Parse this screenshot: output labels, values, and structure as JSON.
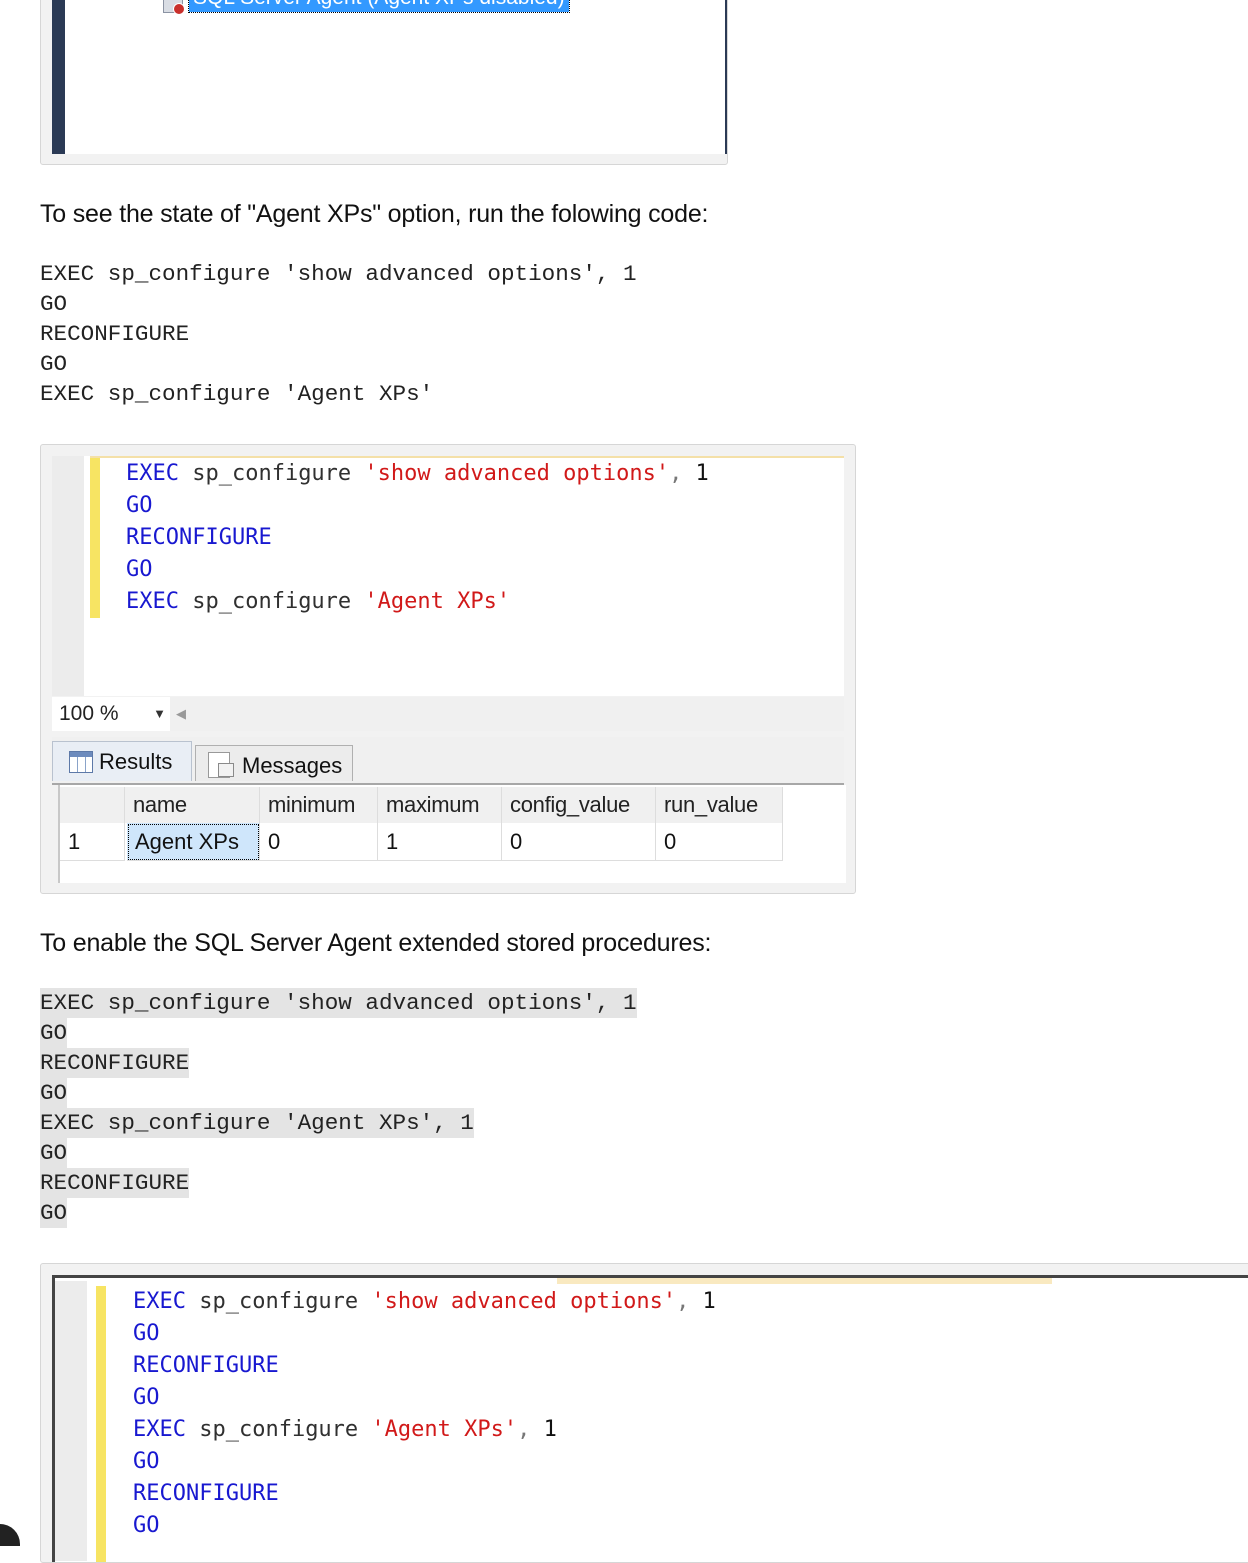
{
  "tree": {
    "node_label": "SQL Server Agent (Agent XPs disabled)"
  },
  "intro_text": "To see the state of \"Agent XPs\" option, run the folowing code:",
  "code1": [
    "EXEC sp_configure 'show advanced options', 1",
    "GO",
    "RECONFIGURE",
    "GO",
    "EXEC sp_configure 'Agent XPs'"
  ],
  "editor1": {
    "lines": [
      {
        "kw": "EXEC",
        "fn": " sp_configure ",
        "str": "'show advanced options'",
        "op": ",",
        "num": " 1"
      },
      {
        "kw": "GO"
      },
      {
        "kw": "RECONFIGURE"
      },
      {
        "kw": "GO"
      },
      {
        "kw": "EXEC",
        "fn": " sp_configure ",
        "str": "'Agent XPs'"
      }
    ],
    "zoom": "100 %",
    "tabs": [
      "Results",
      "Messages"
    ],
    "columns": [
      "name",
      "minimum",
      "maximum",
      "config_value",
      "run_value"
    ],
    "rows": [
      {
        "num": "1",
        "name": "Agent XPs",
        "minimum": "0",
        "maximum": "1",
        "config_value": "0",
        "run_value": "0"
      }
    ]
  },
  "enable_text": "To enable the SQL Server Agent extended stored procedures:",
  "code2": [
    "EXEC sp_configure 'show advanced options', 1",
    "GO",
    "RECONFIGURE",
    "GO",
    "EXEC sp_configure 'Agent XPs', 1",
    "GO",
    "RECONFIGURE",
    "GO"
  ],
  "editor2": {
    "lines": [
      {
        "kw": "EXEC",
        "fn": " sp_configure ",
        "str": "'show advanced options'",
        "op": ",",
        "num": " 1"
      },
      {
        "kw": "GO"
      },
      {
        "kw": "RECONFIGURE"
      },
      {
        "kw": "GO"
      },
      {
        "kw": "EXEC",
        "fn": " sp_configure ",
        "str": "'Agent XPs'",
        "op": ",",
        "num": " 1"
      },
      {
        "kw": "GO"
      },
      {
        "kw": "RECONFIGURE"
      },
      {
        "kw": "GO"
      }
    ]
  },
  "colors": {
    "keyword": "#1818d0",
    "string": "#d11919",
    "selection": "#3399ff",
    "change_bar": "#f7e463"
  }
}
